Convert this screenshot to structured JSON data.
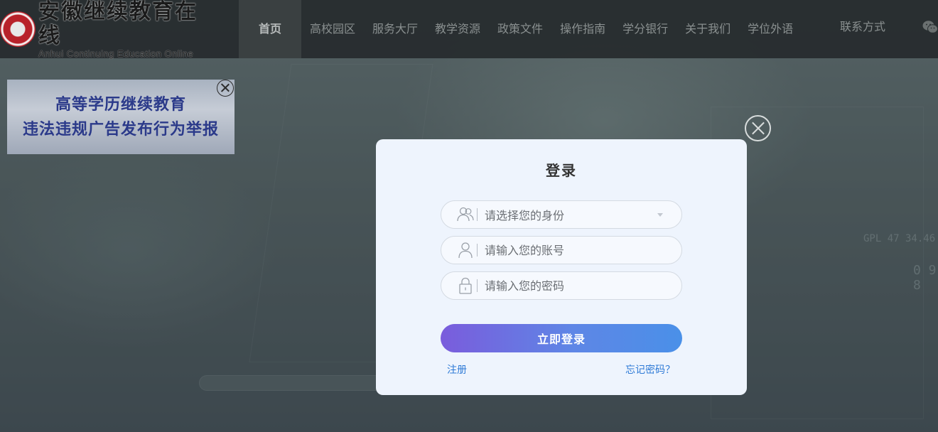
{
  "header": {
    "logo_cn": "安徽继续教育在线",
    "logo_en": "Anhui Continuing Education Online",
    "nav": [
      "首页",
      "高校园区",
      "服务大厅",
      "教学资源",
      "政策文件",
      "操作指南",
      "学分银行",
      "关于我们",
      "学位外语"
    ],
    "contact": "联系方式"
  },
  "banner": {
    "line1": "高等学历继续教育",
    "line2": "违法违规广告发布行为举报"
  },
  "background_text": {
    "n1": "GPL 47 34.46",
    "n2": "0 9 8"
  },
  "login": {
    "title": "登录",
    "identity_placeholder": "请选择您的身份",
    "account_placeholder": "请输入您的账号",
    "password_placeholder": "请输入您的密码",
    "submit_label": "立即登录",
    "register_label": "注册",
    "forgot_label": "忘记密码？"
  },
  "colors": {
    "accent_start": "#7a5cdc",
    "accent_end": "#4a90e8",
    "link": "#2e7ad6",
    "banner_text": "#2b3a8a"
  },
  "icons": {
    "identity": "users-icon",
    "account": "user-icon",
    "password": "lock-icon",
    "share": "wechat-icon"
  }
}
